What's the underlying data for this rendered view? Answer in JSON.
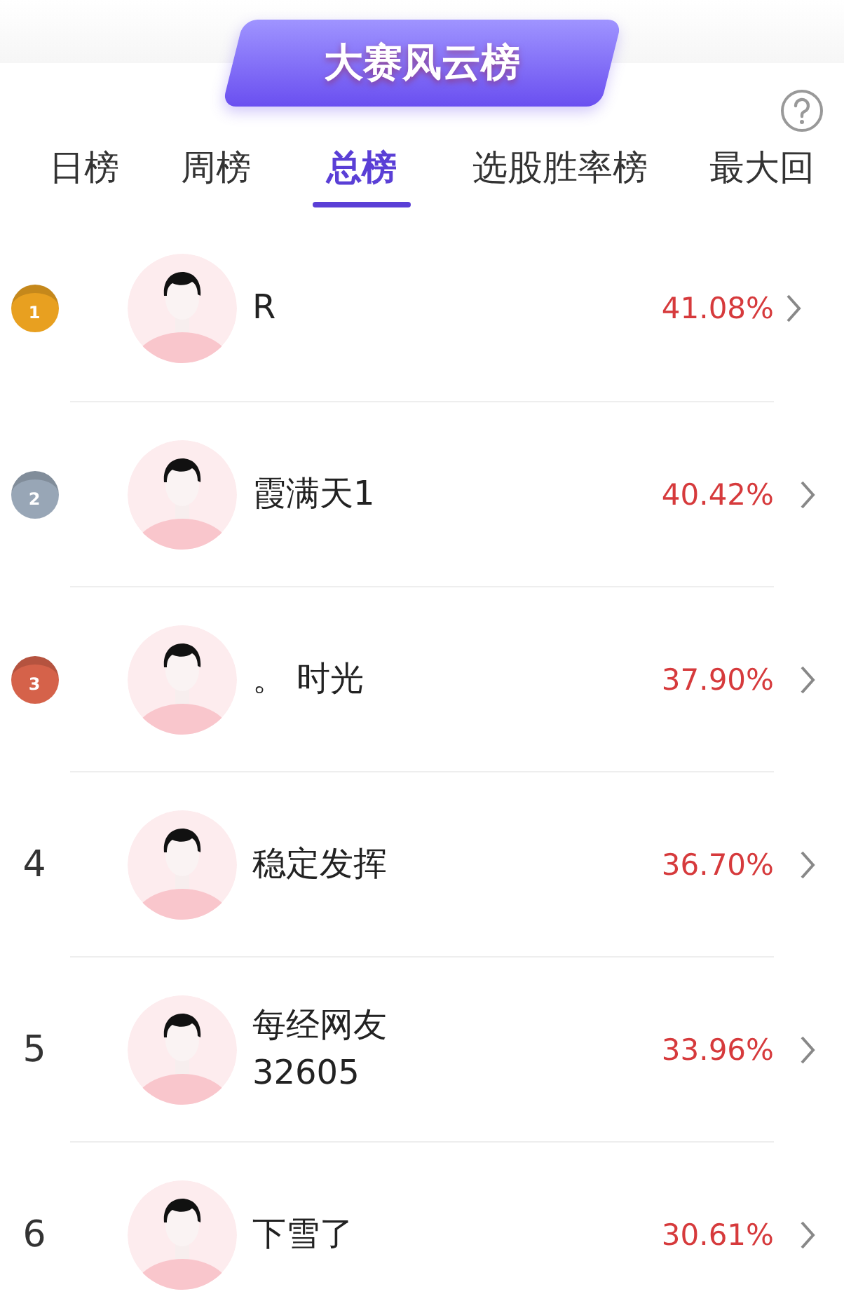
{
  "title": "大赛风云榜",
  "tabs": [
    {
      "label": "日榜",
      "selected": false
    },
    {
      "label": "周榜",
      "selected": false
    },
    {
      "label": "总榜",
      "selected": true
    },
    {
      "label": "选股胜率榜",
      "selected": false
    },
    {
      "label": "最大回",
      "selected": false
    }
  ],
  "rows": [
    {
      "kind": "medal",
      "rank": "1",
      "color": "#e8a020",
      "name": "R",
      "rate": "41.08%"
    },
    {
      "kind": "medal",
      "rank": "2",
      "color": "#98a6b6",
      "name": "霞满天1",
      "rate": "40.42%"
    },
    {
      "kind": "medal",
      "rank": "3",
      "color": "#d5624a",
      "name": "。 时光",
      "rate": "37.90%"
    },
    {
      "kind": "number",
      "rank": "4",
      "name": "稳定发挥",
      "rate": "36.70%"
    },
    {
      "kind": "number",
      "rank": "5",
      "name": "每经网友32605",
      "rate": "33.96%"
    },
    {
      "kind": "number",
      "rank": "6",
      "name": "下雪了",
      "rate": "30.61%"
    }
  ]
}
